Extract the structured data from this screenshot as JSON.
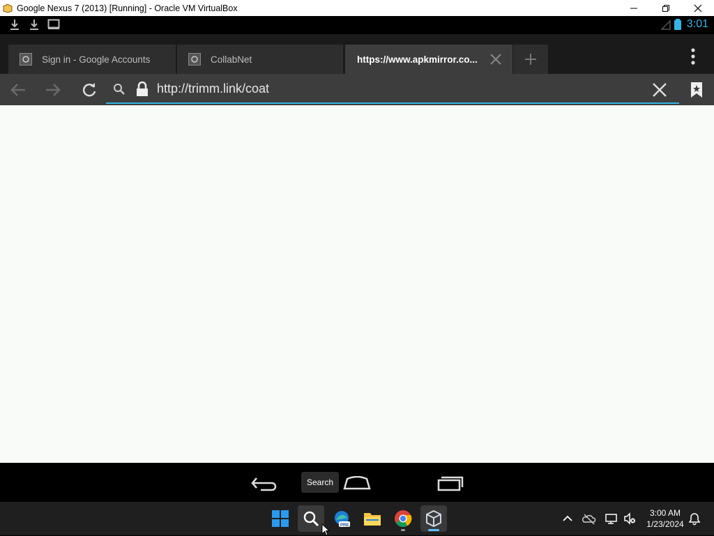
{
  "window": {
    "title": "Google Nexus 7 (2013) [Running] - Oracle VM VirtualBox"
  },
  "android_status": {
    "time": "3:01"
  },
  "browser": {
    "tabs": [
      {
        "label": "Sign in - Google Accounts",
        "active": false
      },
      {
        "label": "CollabNet",
        "active": false
      },
      {
        "label": "https://www.apkmirror.co...",
        "active": true
      }
    ],
    "url": "http://trimm.link/coat"
  },
  "android_nav": {
    "tooltip": "Search"
  },
  "taskbar": {
    "apps": [
      "start",
      "search",
      "edge-beta",
      "file-explorer",
      "chrome",
      "virtualbox"
    ],
    "time": "3:00 AM",
    "date": "1/23/2024"
  },
  "colors": {
    "android_accent": "#33b5e5",
    "tab_active": "#3d3d3d",
    "content_bg": "#f8fbf8"
  }
}
